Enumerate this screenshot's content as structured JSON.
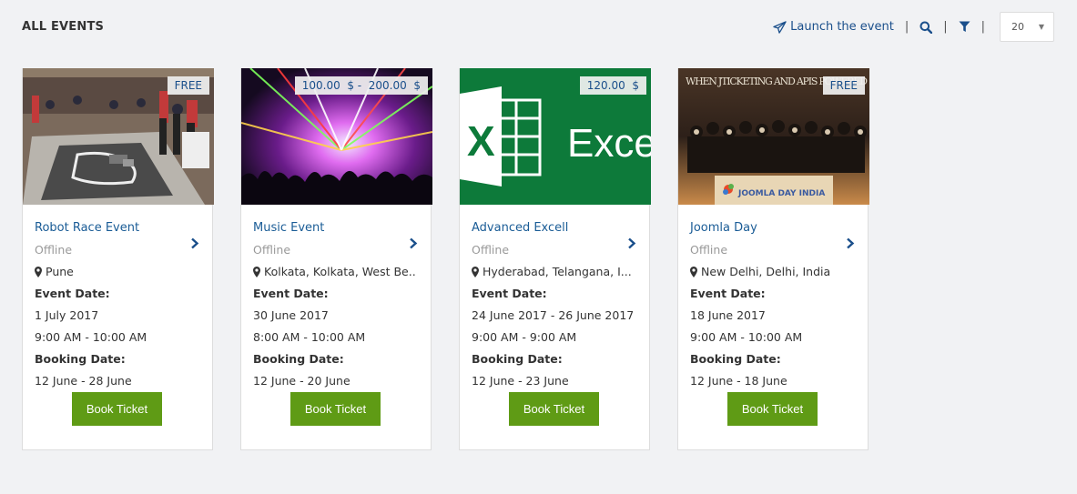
{
  "page": {
    "title": "ALL EVENTS"
  },
  "toolbar": {
    "launch_label": "Launch the event",
    "separator": "|",
    "per_page": "20"
  },
  "colors": {
    "link": "#1a4f8b",
    "button": "#5f9b15",
    "background": "#f1f2f4"
  },
  "icons": {
    "launch": "paper-plane-icon",
    "search": "search-icon",
    "filter": "filter-icon",
    "location": "map-marker-icon",
    "chevron": "chevron-right-icon"
  },
  "labels": {
    "event_date": "Event Date:",
    "booking_date": "Booking Date:",
    "book": "Book Ticket"
  },
  "events": [
    {
      "name": "Robot Race Event",
      "price": "FREE",
      "mode": "Offline",
      "location": "Pune",
      "event_date": "1 July 2017",
      "event_time": "9:00 AM - 10:00 AM",
      "booking_date": "12 June - 28 June"
    },
    {
      "name": "Music Event",
      "price": "100.00  $ -  200.00  $",
      "mode": "Offline",
      "location": "Kolkata, Kolkata, West Be..",
      "event_date": "30 June 2017",
      "event_time": "8:00 AM - 10:00 AM",
      "booking_date": "12 June - 20 June"
    },
    {
      "name": "Advanced Excell",
      "price": "120.00  $",
      "mode": "Offline",
      "location": "Hyderabad, Telangana, I...",
      "event_date": "24 June 2017 - 26 June 2017",
      "event_time": "9:00 AM - 9:00 AM",
      "booking_date": "12 June - 23 June",
      "image_text": "Exce"
    },
    {
      "name": "Joomla Day",
      "price": "FREE",
      "mode": "Offline",
      "location": "New Delhi, Delhi, India",
      "event_date": "18 June 2017",
      "event_time": "9:00 AM - 10:00 AM",
      "booking_date": "12 June - 18 June",
      "image_text": "WHEN JTICKETING AND APIS POWERED",
      "image_logo": "JOOMLA DAY INDIA"
    }
  ]
}
